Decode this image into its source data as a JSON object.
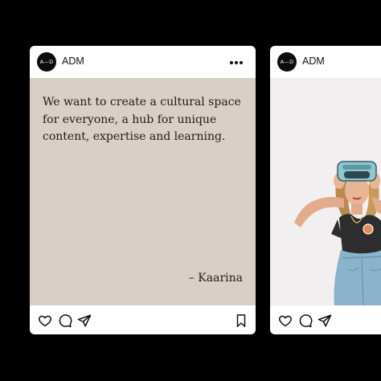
{
  "posts": [
    {
      "avatar_text": "A—D",
      "username": "ADM",
      "quote": "We want to create a cultural space for everyone, a hub for unique content, expertise and learning.",
      "author": "– Kaarina",
      "background": "#d9cfc6"
    },
    {
      "avatar_text": "A—D",
      "username": "ADM",
      "image": "illustration-woman-vr-headset",
      "background": "#f2eff1"
    }
  ],
  "icons": {
    "more": "more-options-icon",
    "like": "heart-icon",
    "comment": "comment-icon",
    "share": "send-icon",
    "save": "bookmark-icon"
  }
}
